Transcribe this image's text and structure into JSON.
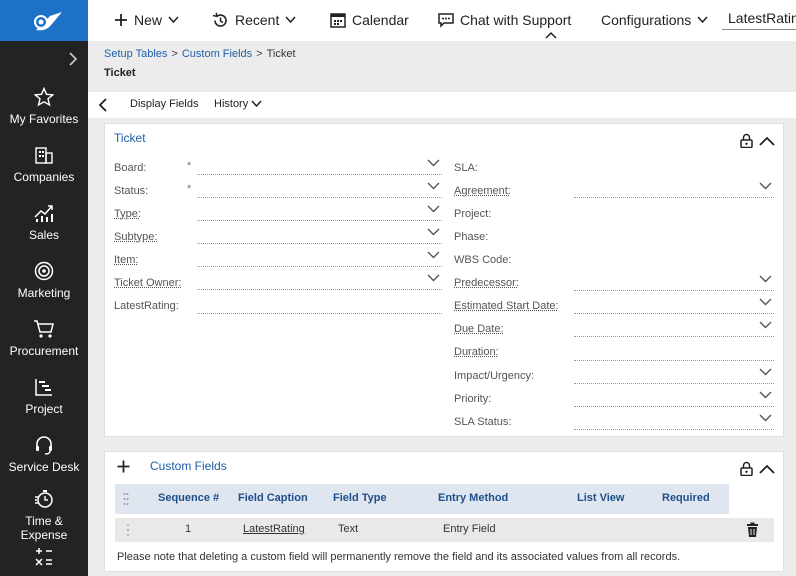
{
  "topbar": {
    "new_label": "New",
    "recent_label": "Recent",
    "calendar_label": "Calendar",
    "chat_label": "Chat with Support",
    "configurations_label": "Configurations",
    "search_value": "LatestRating"
  },
  "sidebar": {
    "items": [
      {
        "label": "My Favorites",
        "icon": "star-icon"
      },
      {
        "label": "Companies",
        "icon": "building-icon"
      },
      {
        "label": "Sales",
        "icon": "chart-icon"
      },
      {
        "label": "Marketing",
        "icon": "target-icon"
      },
      {
        "label": "Procurement",
        "icon": "cart-icon"
      },
      {
        "label": "Project",
        "icon": "project-icon"
      },
      {
        "label": "Service Desk",
        "icon": "headset-icon"
      },
      {
        "label": "Time &\nExpense",
        "icon": "stopwatch-icon"
      },
      {
        "label": "",
        "icon": "calculator-icon"
      }
    ]
  },
  "breadcrumb": {
    "items": [
      "Setup Tables",
      "Custom Fields",
      "Ticket"
    ]
  },
  "page_title": "Ticket",
  "toolbar": {
    "display_fields_label": "Display Fields",
    "history_label": "History"
  },
  "ticket_panel": {
    "title": "Ticket",
    "left_fields": [
      {
        "label": "Board:",
        "required": "*"
      },
      {
        "label": "Status:",
        "required": "*"
      },
      {
        "label": "Type:"
      },
      {
        "label": "Subtype:"
      },
      {
        "label": "Item:"
      },
      {
        "label": "Ticket Owner:"
      },
      {
        "label": "LatestRating:"
      }
    ],
    "right_fields": [
      {
        "label": "SLA:"
      },
      {
        "label": "Agreement:"
      },
      {
        "label": "Project:"
      },
      {
        "label": "Phase:"
      },
      {
        "label": "WBS Code:"
      },
      {
        "label": "Predecessor:"
      },
      {
        "label": "Estimated Start Date:"
      },
      {
        "label": "Due Date:"
      },
      {
        "label": "Duration:"
      },
      {
        "label": "Impact/Urgency:"
      },
      {
        "label": "Priority:"
      },
      {
        "label": "SLA Status:"
      }
    ]
  },
  "custom_fields_panel": {
    "title": "Custom Fields",
    "columns": [
      "Sequence #",
      "Field Caption",
      "Field Type",
      "Entry Method",
      "List View",
      "Required"
    ],
    "rows": [
      {
        "sequence": "1",
        "caption": "LatestRating",
        "type": "Text",
        "entry_method": "Entry Field",
        "list_view": "",
        "required": ""
      }
    ],
    "note": "Please note that deleting a custom field will permanently remove the field and its associated values from all records."
  },
  "colors": {
    "accent": "#1d72c8",
    "link": "#1d5fa8",
    "sidebar_bg": "#232323"
  }
}
